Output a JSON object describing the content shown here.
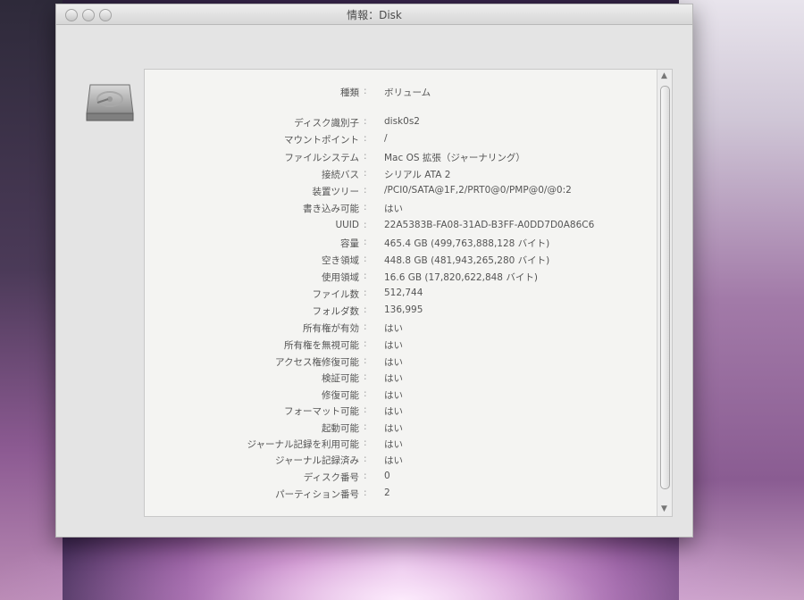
{
  "window": {
    "title": "情報：Disk"
  },
  "icons": {
    "disk_icon": "internal-hard-drive-icon"
  },
  "info_rows": [
    {
      "label": "種類",
      "value": "ボリューム"
    },
    {
      "label": "ディスク識別子",
      "value": "disk0s2"
    },
    {
      "label": "マウントポイント",
      "value": "/"
    },
    {
      "label": "ファイルシステム",
      "value": "Mac OS 拡張（ジャーナリング）"
    },
    {
      "label": "接続バス",
      "value": "シリアル ATA 2"
    },
    {
      "label": "装置ツリー",
      "value": "/PCI0/SATA@1F,2/PRT0@0/PMP@0/@0:2"
    },
    {
      "label": "書き込み可能",
      "value": "はい"
    },
    {
      "label": "UUID",
      "value": "22A5383B-FA08-31AD-B3FF-A0DD7D0A86C6"
    },
    {
      "label": "容量",
      "value": "465.4 GB (499,763,888,128 バイト)"
    },
    {
      "label": "空き領域",
      "value": "448.8 GB (481,943,265,280 バイト)"
    },
    {
      "label": "使用領域",
      "value": "16.6 GB (17,820,622,848 バイト)"
    },
    {
      "label": "ファイル数",
      "value": "512,744"
    },
    {
      "label": "フォルダ数",
      "value": "136,995"
    },
    {
      "label": "所有権が有効",
      "value": "はい"
    },
    {
      "label": "所有権を無視可能",
      "value": "はい"
    },
    {
      "label": "アクセス権修復可能",
      "value": "はい"
    },
    {
      "label": "検証可能",
      "value": "はい"
    },
    {
      "label": "修復可能",
      "value": "はい"
    },
    {
      "label": "フォーマット可能",
      "value": "はい"
    },
    {
      "label": "起動可能",
      "value": "はい"
    },
    {
      "label": "ジャーナル記録を利用可能",
      "value": "はい"
    },
    {
      "label": "ジャーナル記録済み",
      "value": "はい"
    },
    {
      "label": "ディスク番号",
      "value": "0"
    },
    {
      "label": "パーティション番号",
      "value": "2"
    }
  ]
}
